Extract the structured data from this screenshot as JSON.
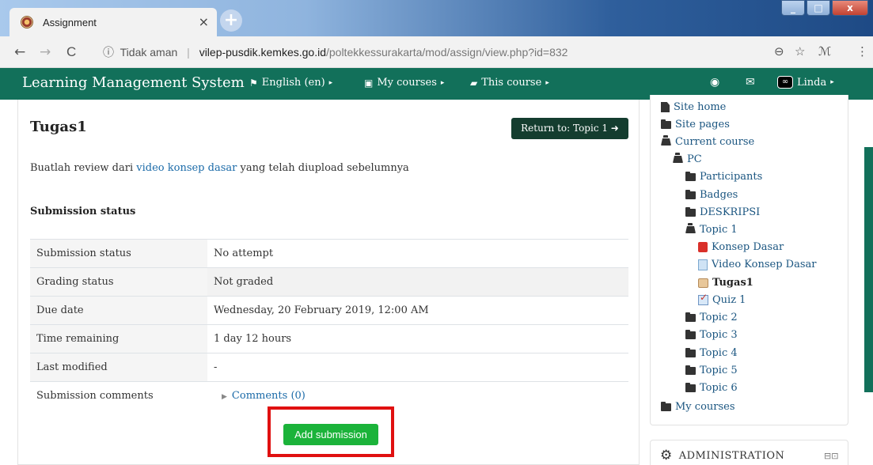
{
  "browser": {
    "tab_title": "Assignment",
    "tab_close": "×",
    "new_tab": "+",
    "url_info_icon": "ⓘ",
    "url_not_secure": "Tidak aman",
    "url_separator": "|",
    "url_host": "vilep-pusdik.kemkes.go.id",
    "url_path": "/poltekkessurakarta/mod/assign/view.php?id=832",
    "back": "←",
    "forward": "→",
    "reload": "C",
    "zoom_icon": "⊖",
    "star_icon": "☆",
    "ext_icon": "ℳ",
    "menu_icon": "⋮",
    "win_min": "_",
    "win_max": "□",
    "win_close": "x"
  },
  "navbar": {
    "brand": "Learning Management System",
    "language": "English (en)",
    "my_courses": "My courses",
    "this_course": "This course",
    "user": "Linda",
    "user_avatar": "∞",
    "caret": "▸",
    "lang_icon": "⚑",
    "courses_icon": "▣",
    "course_icon": "▰",
    "globe_icon": "◉",
    "mail_icon": "✉"
  },
  "main": {
    "title": "Tugas1",
    "return_button": "Return to: Topic 1 ➜",
    "intro_before": "Buatlah review dari ",
    "intro_link": "video konsep dasar",
    "intro_after": " yang telah diupload sebelumnya",
    "section_heading": "Submission status",
    "rows": [
      {
        "label": "Submission status",
        "value": "No attempt"
      },
      {
        "label": "Grading status",
        "value": "Not graded"
      },
      {
        "label": "Due date",
        "value": "Wednesday, 20 February 2019, 12:00 AM"
      },
      {
        "label": "Time remaining",
        "value": "1 day 12 hours"
      },
      {
        "label": "Last modified",
        "value": "-"
      },
      {
        "label": "Submission comments",
        "value": "Comments (0)"
      }
    ],
    "comments_toggle": "▶",
    "add_submission": "Add submission"
  },
  "sidebar": {
    "site_home": "Site home",
    "site_pages": "Site pages",
    "current_course": "Current course",
    "course": "PC",
    "participants": "Participants",
    "badges": "Badges",
    "deskripsi": "DESKRIPSI",
    "topic1": "Topic 1",
    "konsep_dasar": "Konsep Dasar",
    "video_konsep_dasar": "Video Konsep Dasar",
    "tugas1": "Tugas1",
    "quiz1": "Quiz 1",
    "topic2": "Topic 2",
    "topic3": "Topic 3",
    "topic4": "Topic 4",
    "topic5": "Topic 5",
    "topic6": "Topic 6",
    "my_courses": "My courses",
    "admin_title": "ADMINISTRATION",
    "admin_gears": "⚙",
    "admin_controls": "⊟⊡"
  },
  "colors": {
    "navbar": "#12705a",
    "return_button": "#143d2f",
    "add_submission": "#1bb33a",
    "highlight": "#e01010",
    "link": "#1a6aa8"
  }
}
